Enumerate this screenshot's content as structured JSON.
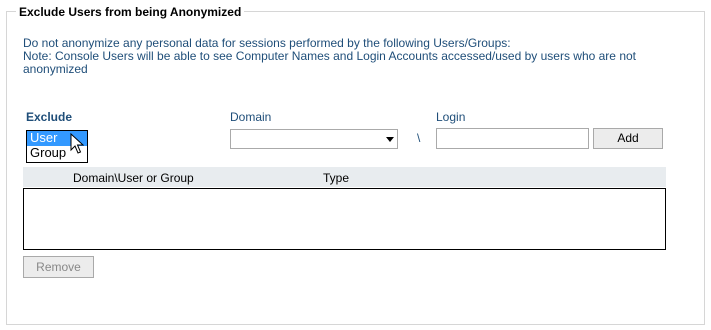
{
  "panel": {
    "title": "Exclude Users from being Anonymized",
    "description_line1": "Do not anonymize any personal data for sessions performed by the following Users/Groups:",
    "description_line2": "Note: Console Users will be able to see Computer Names and Login Accounts accessed/used by users who are not anonymized"
  },
  "form": {
    "exclude_label": "Exclude",
    "exclude_options": [
      "User",
      "Group"
    ],
    "exclude_selected": "User",
    "domain_label": "Domain",
    "domain_value": "",
    "separator": "\\",
    "login_label": "Login",
    "login_value": "",
    "add_label": "Add"
  },
  "table": {
    "columns": [
      "Domain\\User or Group",
      "Type"
    ],
    "rows": []
  },
  "actions": {
    "remove_label": "Remove"
  },
  "icons": {
    "cursor": "mouse-pointer-icon",
    "dropdown": "chevron-down-icon"
  }
}
